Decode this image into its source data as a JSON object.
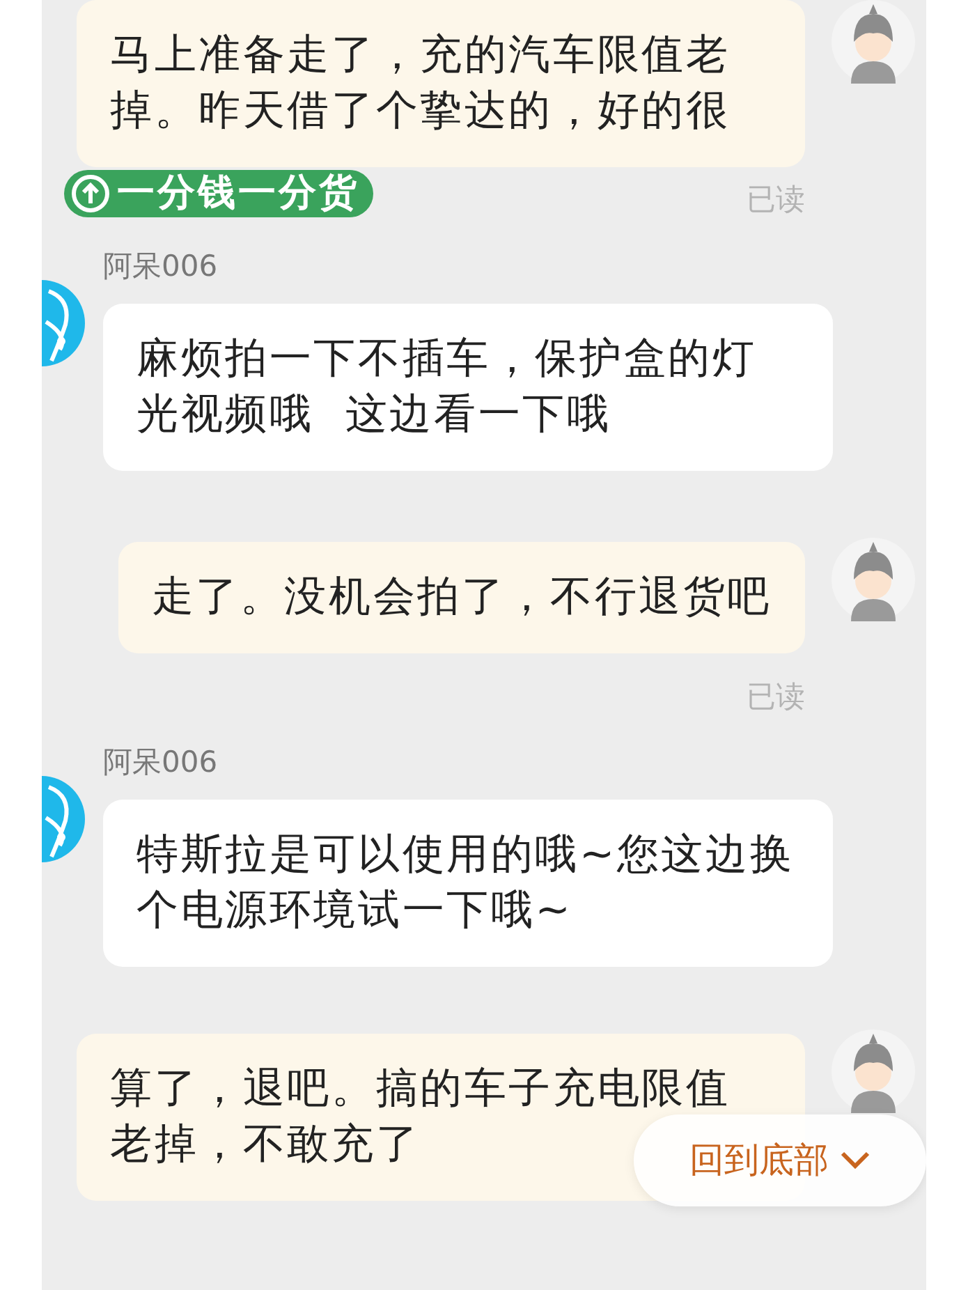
{
  "messages": [
    {
      "kind": "sent",
      "text": "马上准备走了，充的汽车限值老掉。昨天借了个挚达的，好的很",
      "sticker": "一分钱一分货",
      "receipt": "已读"
    },
    {
      "kind": "received",
      "sender": "阿呆006",
      "text": "麻烦拍一下不插车，保护盒的灯光视频哦  这边看一下哦"
    },
    {
      "kind": "sent",
      "text": "走了。没机会拍了，不行退货吧",
      "receipt": "已读"
    },
    {
      "kind": "received",
      "sender": "阿呆006",
      "text": "特斯拉是可以使用的哦~您这边换个电源环境试一下哦~"
    },
    {
      "kind": "sent",
      "text": "算了，退吧。搞的车子充电限值老掉，不敢充了"
    }
  ],
  "scroll_button": {
    "label": "回到底部"
  }
}
